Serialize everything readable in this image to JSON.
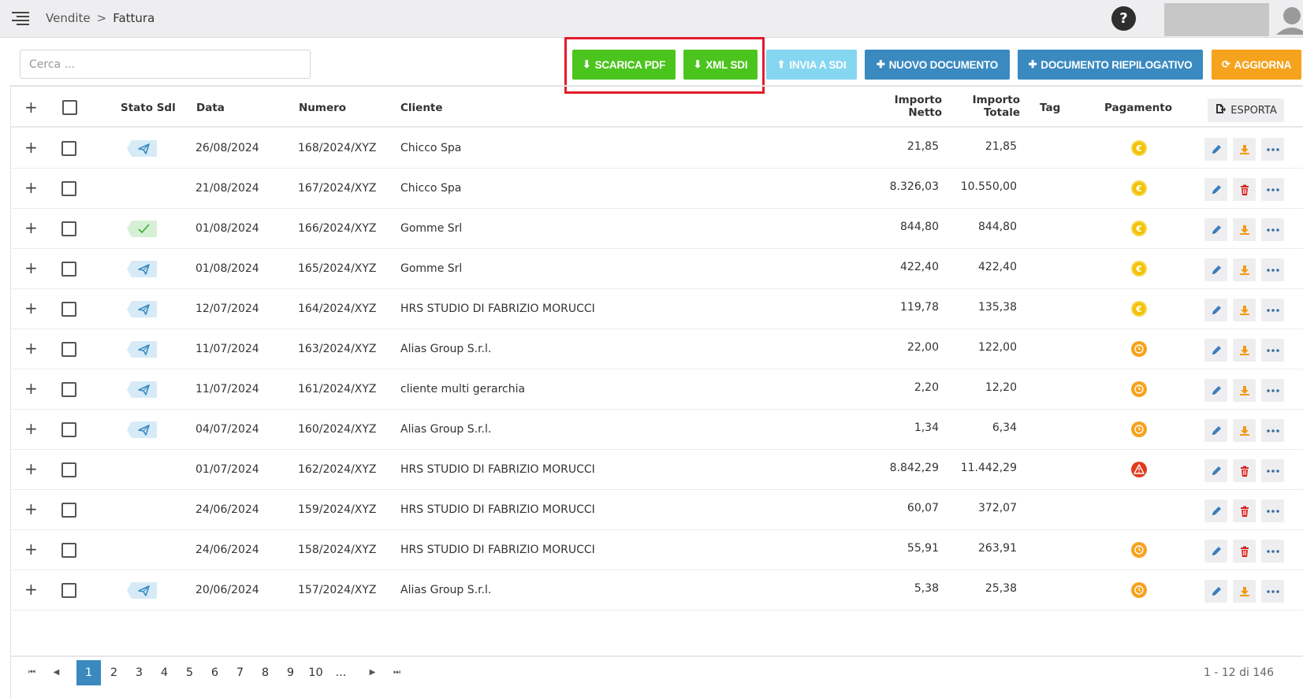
{
  "header": {
    "breadcrumb": [
      "Vendite",
      "Fattura"
    ],
    "breadcrumb_separator": ">",
    "help_label": "?"
  },
  "toolbar": {
    "search_placeholder": "Cerca ...",
    "search_value": "",
    "buttons": {
      "scarica_pdf": "SCARICA PDF",
      "xml_sdi": "XML SDI",
      "invia_sdi": "INVIA A SDI",
      "nuovo_documento": "NUOVO DOCUMENTO",
      "documento_riepilogativo": "DOCUMENTO RIEPILOGATIVO",
      "aggiorna": "AGGIORNA"
    },
    "highlight_color": "#e21c2c"
  },
  "table": {
    "headers": {
      "stato_sdi": "Stato Sdl",
      "data": "Data",
      "numero": "Numero",
      "cliente": "Cliente",
      "importo_netto_1": "Importo",
      "importo_netto_2": "Netto",
      "importo_totale_1": "Importo",
      "importo_totale_2": "Totale",
      "tag": "Tag",
      "pagamento": "Pagamento",
      "esporta": "ESPORTA"
    },
    "rows": [
      {
        "sdi": "sent",
        "data": "26/08/2024",
        "numero": "168/2024/XYZ",
        "cliente": "Chicco Spa",
        "netto": "21,85",
        "totale": "21,85",
        "pagamento": "euro",
        "action2": "download"
      },
      {
        "sdi": "none",
        "data": "21/08/2024",
        "numero": "167/2024/XYZ",
        "cliente": "Chicco Spa",
        "netto": "8.326,03",
        "totale": "10.550,00",
        "pagamento": "euro",
        "action2": "delete"
      },
      {
        "sdi": "accepted",
        "data": "01/08/2024",
        "numero": "166/2024/XYZ",
        "cliente": "Gomme Srl",
        "netto": "844,80",
        "totale": "844,80",
        "pagamento": "euro",
        "action2": "download"
      },
      {
        "sdi": "sent",
        "data": "01/08/2024",
        "numero": "165/2024/XYZ",
        "cliente": "Gomme Srl",
        "netto": "422,40",
        "totale": "422,40",
        "pagamento": "euro",
        "action2": "download"
      },
      {
        "sdi": "sent",
        "data": "12/07/2024",
        "numero": "164/2024/XYZ",
        "cliente": "HRS STUDIO DI FABRIZIO MORUCCI",
        "netto": "119,78",
        "totale": "135,38",
        "pagamento": "euro",
        "action2": "download"
      },
      {
        "sdi": "sent",
        "data": "11/07/2024",
        "numero": "163/2024/XYZ",
        "cliente": "Alias Group S.r.l.",
        "netto": "22,00",
        "totale": "122,00",
        "pagamento": "clock",
        "action2": "download"
      },
      {
        "sdi": "sent",
        "data": "11/07/2024",
        "numero": "161/2024/XYZ",
        "cliente": "cliente multi gerarchia",
        "netto": "2,20",
        "totale": "12,20",
        "pagamento": "clock",
        "action2": "download"
      },
      {
        "sdi": "sent",
        "data": "04/07/2024",
        "numero": "160/2024/XYZ",
        "cliente": "Alias Group S.r.l.",
        "netto": "1,34",
        "totale": "6,34",
        "pagamento": "clock",
        "action2": "download"
      },
      {
        "sdi": "none",
        "data": "01/07/2024",
        "numero": "162/2024/XYZ",
        "cliente": "HRS STUDIO DI FABRIZIO MORUCCI",
        "netto": "8.842,29",
        "totale": "11.442,29",
        "pagamento": "warning",
        "action2": "delete"
      },
      {
        "sdi": "none",
        "data": "24/06/2024",
        "numero": "159/2024/XYZ",
        "cliente": "HRS STUDIO DI FABRIZIO MORUCCI",
        "netto": "60,07",
        "totale": "372,07",
        "pagamento": "none",
        "action2": "delete"
      },
      {
        "sdi": "none",
        "data": "24/06/2024",
        "numero": "158/2024/XYZ",
        "cliente": "HRS STUDIO DI FABRIZIO MORUCCI",
        "netto": "55,91",
        "totale": "263,91",
        "pagamento": "clock",
        "action2": "delete"
      },
      {
        "sdi": "sent",
        "data": "20/06/2024",
        "numero": "157/2024/XYZ",
        "cliente": "Alias Group S.r.l.",
        "netto": "5,38",
        "totale": "25,38",
        "pagamento": "clock",
        "action2": "download"
      }
    ]
  },
  "pagination": {
    "pages": [
      "1",
      "2",
      "3",
      "4",
      "5",
      "6",
      "7",
      "8",
      "9",
      "10",
      "..."
    ],
    "current_page": "1",
    "info": "1 - 12 di 146"
  },
  "colors": {
    "green": "#4cc41e",
    "light_blue": "#85d6f1",
    "blue": "#3a8ac0",
    "orange": "#f5a21c",
    "euro_yellow": "#f2c20a",
    "delete_red": "#d9231e",
    "download_orange": "#f39a12",
    "edit_blue": "#3a7fbf"
  }
}
